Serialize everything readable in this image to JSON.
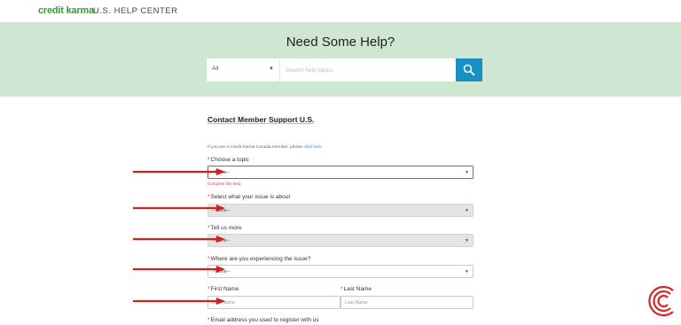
{
  "header": {
    "logo_text": "credit karma",
    "section_title": "U.S. HELP CENTER"
  },
  "hero": {
    "title": "Need Some Help?",
    "search": {
      "category_value": "All",
      "placeholder": "Search help topics",
      "button_icon": "search-icon"
    }
  },
  "form": {
    "title": "Contact Member Support U.S.",
    "canada_note": "If you are a Credit Karma Canada member, please",
    "canada_link": "click here.",
    "required_marker": "*",
    "topic": {
      "label": "Choose a topic",
      "value": "--None--",
      "error": "Complete this field."
    },
    "issue": {
      "label": "Select what your issue is about",
      "value": "--None--"
    },
    "more": {
      "label": "Tell us more",
      "value": "--None--"
    },
    "where": {
      "label": "Where are you experiencing the issue?",
      "value": "--None--"
    },
    "first_name": {
      "label": "First Name",
      "placeholder": "First Name"
    },
    "last_name": {
      "label": "Last Name",
      "placeholder": "Last Name"
    },
    "email": {
      "label": "Email address you used to register with us"
    }
  },
  "colors": {
    "brand_green": "#3a9b3a",
    "hero_bg": "#cfe6d3",
    "search_button": "#1a8fc1",
    "error_red": "#c8484c",
    "annotation_arrow": "#cc2222"
  },
  "watermark_icon": "c-logo-icon"
}
